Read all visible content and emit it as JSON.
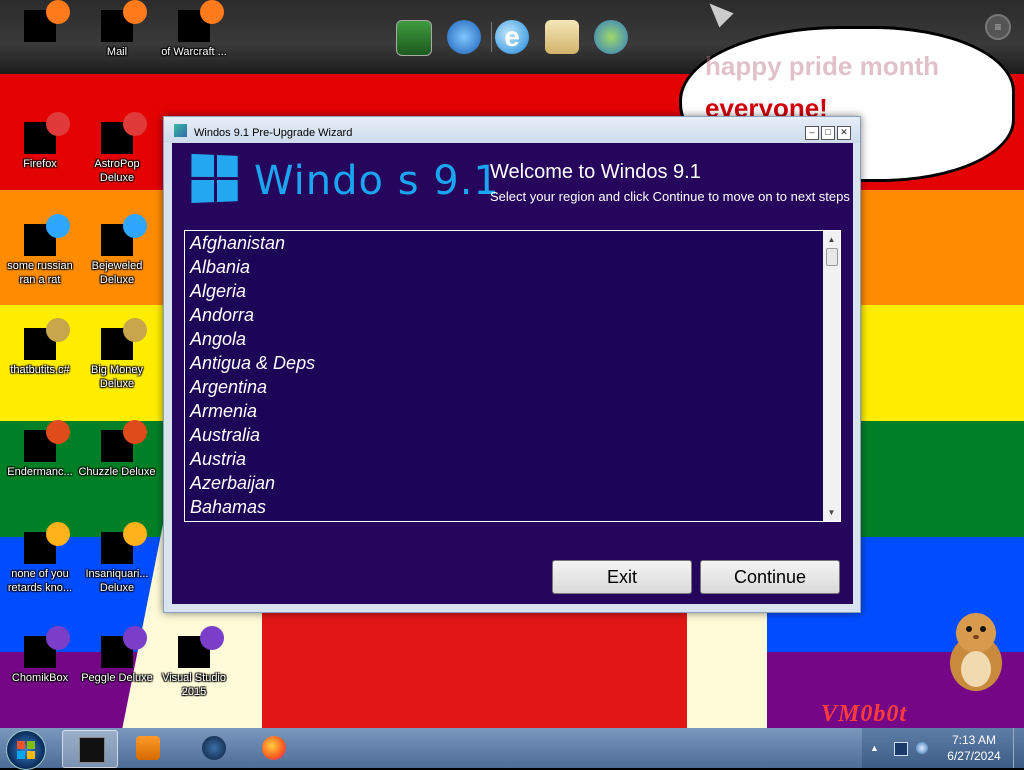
{
  "desktop": {
    "stripe_colors": [
      "#e40303",
      "#ff8c00",
      "#ffed00",
      "#008026",
      "#004dff",
      "#750787"
    ],
    "speech_bubble": {
      "line1_partial": "happy pride month",
      "line2": "everyone!"
    },
    "signature": "VM0b0t",
    "icons": [
      {
        "name": "icon-top-1",
        "label": "",
        "col": 0,
        "row": 0
      },
      {
        "name": "icon-mail",
        "label": "Mail",
        "col": 1,
        "row": 0
      },
      {
        "name": "icon-warcraft",
        "label": "of Warcraft ...",
        "col": 2,
        "row": 0
      },
      {
        "name": "icon-firefox",
        "label": "Firefox",
        "col": 0,
        "row": 1
      },
      {
        "name": "icon-astropop",
        "label": "AstroPop Deluxe",
        "col": 1,
        "row": 1
      },
      {
        "name": "icon-some-russian",
        "label": "some russian ran a rat",
        "col": 0,
        "row": 2
      },
      {
        "name": "icon-bejeweled",
        "label": "Bejeweled Deluxe",
        "col": 1,
        "row": 2
      },
      {
        "name": "icon-that-but",
        "label": "thatbutits.c#",
        "col": 0,
        "row": 3
      },
      {
        "name": "icon-big-money",
        "label": "Big Money Deluxe",
        "col": 1,
        "row": 3
      },
      {
        "name": "icon-enderman",
        "label": "Endermanc...",
        "col": 0,
        "row": 4
      },
      {
        "name": "icon-chuzzle",
        "label": "Chuzzle Deluxe",
        "col": 1,
        "row": 4
      },
      {
        "name": "icon-none-of-you",
        "label": "none of you retards kno...",
        "col": 0,
        "row": 5
      },
      {
        "name": "icon-insaniquarium",
        "label": "Insaniquari... Deluxe",
        "col": 1,
        "row": 5
      },
      {
        "name": "icon-chomikbox",
        "label": "ChomikBox",
        "col": 0,
        "row": 6
      },
      {
        "name": "icon-peggle",
        "label": "Peggle Deluxe",
        "col": 1,
        "row": 6
      },
      {
        "name": "icon-visual-studio",
        "label": "Visual Studio 2015",
        "col": 2,
        "row": 6
      }
    ]
  },
  "window": {
    "title": "Windos 9.1 Pre-Upgrade Wizard",
    "logo_text": "Windo s 9.1",
    "heading": "Welcome to Windos 9.1",
    "subheading": "Select your region and click Continue to move on to next steps",
    "countries": [
      "Afghanistan",
      "Albania",
      "Algeria",
      "Andorra",
      "Angola",
      "Antigua & Deps",
      "Argentina",
      "Armenia",
      "Australia",
      "Austria",
      "Azerbaijan",
      "Bahamas"
    ],
    "buttons": {
      "exit": "Exit",
      "continue": "Continue"
    }
  },
  "taskbar": {
    "clock_time": "7:13 AM",
    "clock_date": "6/27/2024"
  }
}
